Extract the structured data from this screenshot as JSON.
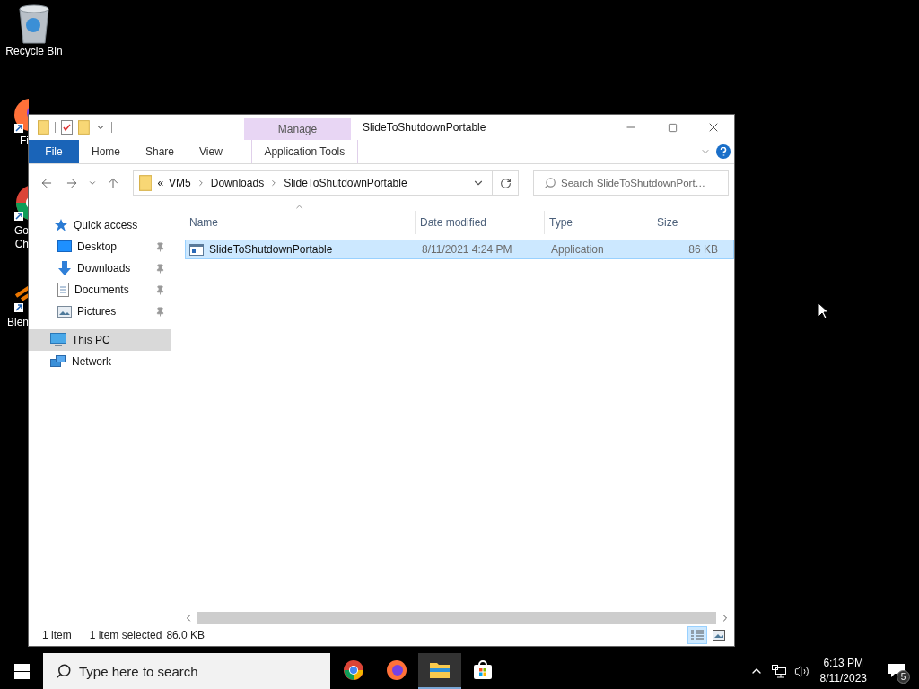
{
  "desktop_icons": [
    {
      "kind": "recycle",
      "label_lines": [
        "Recycle Bin"
      ],
      "covered": false
    },
    {
      "kind": "firefox",
      "label_lines": [
        "Fi"
      ],
      "covered": true
    },
    {
      "kind": "chrome",
      "label_lines": [
        "Go",
        "Ch"
      ],
      "covered": true
    },
    {
      "kind": "blender",
      "label_lines": [
        "Blen"
      ],
      "covered": true
    }
  ],
  "window": {
    "title": "SlideToShutdownPortable",
    "contextual_group": "Manage",
    "ribbon_tabs": [
      {
        "kind": "file",
        "label": "File"
      },
      {
        "kind": "tab",
        "label": "Home"
      },
      {
        "kind": "tab",
        "label": "Share"
      },
      {
        "kind": "tab",
        "label": "View"
      },
      {
        "kind": "contextual",
        "label": "Application Tools"
      }
    ],
    "address": {
      "overflow": "«",
      "crumbs": [
        "VM5",
        "Downloads",
        "SlideToShutdownPortable"
      ]
    },
    "search": {
      "placeholder": "Search SlideToShutdownPort…"
    },
    "nav": [
      {
        "kind": "quick",
        "label": "Quick access",
        "selected": false,
        "children": [
          {
            "kind": "desktop",
            "label": "Desktop",
            "selected": false,
            "pinned": true
          },
          {
            "kind": "downloads",
            "label": "Downloads",
            "selected": false,
            "pinned": true
          },
          {
            "kind": "documents",
            "label": "Documents",
            "selected": false,
            "pinned": true
          },
          {
            "kind": "pictures",
            "label": "Pictures",
            "selected": false,
            "pinned": true
          }
        ]
      },
      {
        "kind": "pc",
        "label": "This PC",
        "selected": true
      },
      {
        "kind": "network",
        "label": "Network",
        "selected": false
      }
    ],
    "columns": [
      {
        "label": "Name",
        "sorted": true
      },
      {
        "label": "Date modified",
        "sorted": false
      },
      {
        "label": "Type",
        "sorted": false
      },
      {
        "label": "Size",
        "sorted": false
      }
    ],
    "rows": [
      {
        "name": "SlideToShutdownPortable",
        "date": "8/11/2021 4:24 PM",
        "type": "Application",
        "size": "86 KB",
        "selected": true
      }
    ],
    "status": {
      "count": "1 item",
      "selection": "1 item selected",
      "size": "86.0 KB"
    },
    "view_buttons": [
      {
        "kind": "details",
        "selected": true
      },
      {
        "kind": "large",
        "selected": false
      }
    ]
  },
  "taskbar": {
    "search_placeholder": "Type here to search",
    "apps": [
      {
        "kind": "chrome",
        "active": false
      },
      {
        "kind": "firefox",
        "active": false
      },
      {
        "kind": "explorer",
        "active": true
      },
      {
        "kind": "store",
        "active": false
      }
    ],
    "time": "6:13 PM",
    "date": "8/11/2023",
    "notifications": "5"
  }
}
